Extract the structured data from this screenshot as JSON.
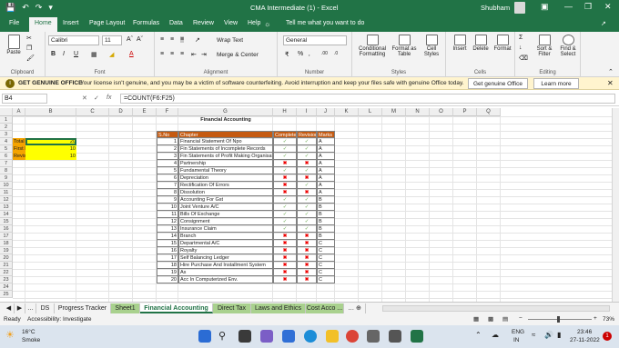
{
  "titlebar": {
    "title": "CMA Intermediate (1)  -  Excel",
    "user": "Shubham"
  },
  "tabs": [
    "File",
    "Home",
    "Insert",
    "Page Layout",
    "Formulas",
    "Data",
    "Review",
    "View",
    "Help"
  ],
  "tell_me": "Tell me what you want to do",
  "ribbon": {
    "clipboard": {
      "paste": "Paste",
      "label": "Clipboard"
    },
    "font": {
      "name": "Calibri",
      "size": "11",
      "label": "Font",
      "bold": "B",
      "italic": "I",
      "underline": "U"
    },
    "alignment": {
      "wrap": "Wrap Text",
      "merge": "Merge & Center",
      "label": "Alignment"
    },
    "number": {
      "format": "General",
      "label": "Number"
    },
    "styles": {
      "conditional": "Conditional Formatting",
      "format_table": "Format as Table",
      "cell_styles": "Cell Styles",
      "label": "Styles"
    },
    "cells": {
      "insert": "Insert",
      "delete": "Delete",
      "format": "Format",
      "label": "Cells"
    },
    "editing": {
      "sort": "Sort & Filter",
      "find": "Find & Select",
      "label": "Editing"
    }
  },
  "message": {
    "title": "GET GENUINE OFFICE",
    "text": "Your license isn't genuine, and you may be a victim of software counterfeiting. Avoid interruption and keep your files safe with genuine Office today.",
    "btn_genuine": "Get genuine Office",
    "btn_learn": "Learn more"
  },
  "formula_bar": {
    "name_box": "B4",
    "fx": "fx",
    "formula": "=COUNT(F6:F25)"
  },
  "columns": [
    "A",
    "B",
    "C",
    "D",
    "E",
    "F",
    "G",
    "H",
    "I",
    "J",
    "K",
    "L",
    "M",
    "N",
    "O",
    "P",
    "Q"
  ],
  "summary": [
    {
      "label": "Total",
      "value": "20"
    },
    {
      "label": "First Reading",
      "value": "10"
    },
    {
      "label": "Revision",
      "value": "10"
    }
  ],
  "table": {
    "title": "Financial Accounting",
    "headers": [
      "S.No",
      "Chapter",
      "Completed",
      "Revision",
      "Marks"
    ],
    "rows": [
      {
        "n": "1",
        "c": "Financial Statement Of Npo",
        "h": "check",
        "i": "check",
        "j": "A"
      },
      {
        "n": "2",
        "c": "Fin Statements of Incomplete Records",
        "h": "check",
        "i": "check",
        "j": "A"
      },
      {
        "n": "3",
        "c": "Fin Statements of Profit Making Organisations",
        "h": "check",
        "i": "check",
        "j": "A"
      },
      {
        "n": "4",
        "c": "Partnership",
        "h": "cross",
        "i": "cross",
        "j": "A"
      },
      {
        "n": "5",
        "c": "Fundamental Theory",
        "h": "check",
        "i": "check",
        "j": "A"
      },
      {
        "n": "6",
        "c": "Depreciation",
        "h": "cross",
        "i": "cross",
        "j": "A"
      },
      {
        "n": "7",
        "c": "Rectification Of Errors",
        "h": "cross",
        "i": "check",
        "j": "A"
      },
      {
        "n": "8",
        "c": "Dissolution",
        "h": "cross",
        "i": "cross",
        "j": "A"
      },
      {
        "n": "9",
        "c": "Accounting For Gst",
        "h": "check",
        "i": "check",
        "j": "B"
      },
      {
        "n": "10",
        "c": "Joint Venture A/C",
        "h": "check",
        "i": "check",
        "j": "B"
      },
      {
        "n": "11",
        "c": "Bills Of Exchange",
        "h": "check",
        "i": "check",
        "j": "B"
      },
      {
        "n": "12",
        "c": "Consignment",
        "h": "check",
        "i": "check",
        "j": "B"
      },
      {
        "n": "13",
        "c": "Insurance Claim",
        "h": "check",
        "i": "check",
        "j": "B"
      },
      {
        "n": "14",
        "c": "Branch",
        "h": "cross",
        "i": "cross",
        "j": "B"
      },
      {
        "n": "15",
        "c": "Departmental A/C",
        "h": "cross",
        "i": "cross",
        "j": "C"
      },
      {
        "n": "16",
        "c": "Royalty",
        "h": "cross",
        "i": "cross",
        "j": "C"
      },
      {
        "n": "17",
        "c": "Self Balancing Ledger",
        "h": "cross",
        "i": "cross",
        "j": "C"
      },
      {
        "n": "18",
        "c": "Hire Purchase And Installment System",
        "h": "cross",
        "i": "cross",
        "j": "C"
      },
      {
        "n": "19",
        "c": "As",
        "h": "cross",
        "i": "cross",
        "j": "C"
      },
      {
        "n": "20",
        "c": "Acc In Computerized Env.",
        "h": "cross",
        "i": "cross",
        "j": "C"
      }
    ]
  },
  "sheet_tabs": [
    "DS",
    "Progress Tracker",
    "Sheet1",
    "Financial Accounting",
    "Direct Tax",
    "Laws and Ethics",
    "Cost Acco ..."
  ],
  "status": {
    "ready": "Ready",
    "accessibility": "Accessibility: Investigate",
    "zoom": "73%"
  },
  "taskbar": {
    "temp": "16°C",
    "weather": "Smoke",
    "lang1": "ENG",
    "lang2": "IN",
    "time": "23:46",
    "date": "27-11-2022",
    "notif": "1"
  },
  "colors": {
    "excel_green": "#217346",
    "orange": "#f4a300",
    "yellow": "#ffff00",
    "header_brown": "#c55a11",
    "cross": "#e00000",
    "check": "#6aa84f"
  }
}
